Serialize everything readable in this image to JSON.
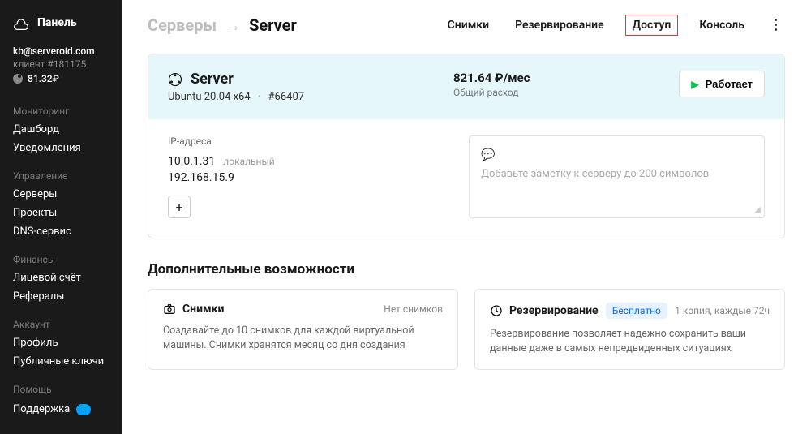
{
  "brand": {
    "title": "Панель"
  },
  "user": {
    "email": "kb@serveroid.com",
    "client": "клиент #181175",
    "balance": "81.32₽"
  },
  "nav": {
    "monitoring": {
      "title": "Мониторинг",
      "items": [
        "Дашборд",
        "Уведомления"
      ]
    },
    "management": {
      "title": "Управление",
      "items": [
        "Серверы",
        "Проекты",
        "DNS-сервис"
      ]
    },
    "finance": {
      "title": "Финансы",
      "items": [
        "Лицевой счёт",
        "Рефералы"
      ]
    },
    "account": {
      "title": "Аккаунт",
      "items": [
        "Профиль",
        "Публичные ключи"
      ]
    },
    "help": {
      "title": "Помощь",
      "support": "Поддержка",
      "badge": "1"
    }
  },
  "crumbs": {
    "root": "Серверы",
    "arrow": "→",
    "current": "Server"
  },
  "tabs": {
    "snapshots": "Снимки",
    "backup": "Резервирование",
    "access": "Доступ",
    "console": "Консоль"
  },
  "server": {
    "name": "Server",
    "os": "Ubuntu 20.04 x64",
    "id": "#66407",
    "price": "821.64 ₽/мес",
    "price_sub": "Общий расход",
    "state": "Работает",
    "ip_title": "IP-адреса",
    "ip1": "10.0.1.31",
    "ip1_tag": "локальный",
    "ip2": "192.168.15.9",
    "note_placeholder": "Добавьте заметку к серверу до 200 символов"
  },
  "extras": {
    "title": "Дополнительные возможности",
    "snapshots": {
      "name": "Снимки",
      "meta": "Нет снимков",
      "desc": "Создавайте до 10 снимков для каждой виртуальной машины. Снимки хранятся месяц со дня создания"
    },
    "backup": {
      "name": "Резервирование",
      "badge": "Бесплатно",
      "meta": "1 копия, каждые 72ч",
      "desc": "Резервирование позволяет надежно сохранить ваши данные даже в самых непредвиденных ситуациях"
    }
  }
}
